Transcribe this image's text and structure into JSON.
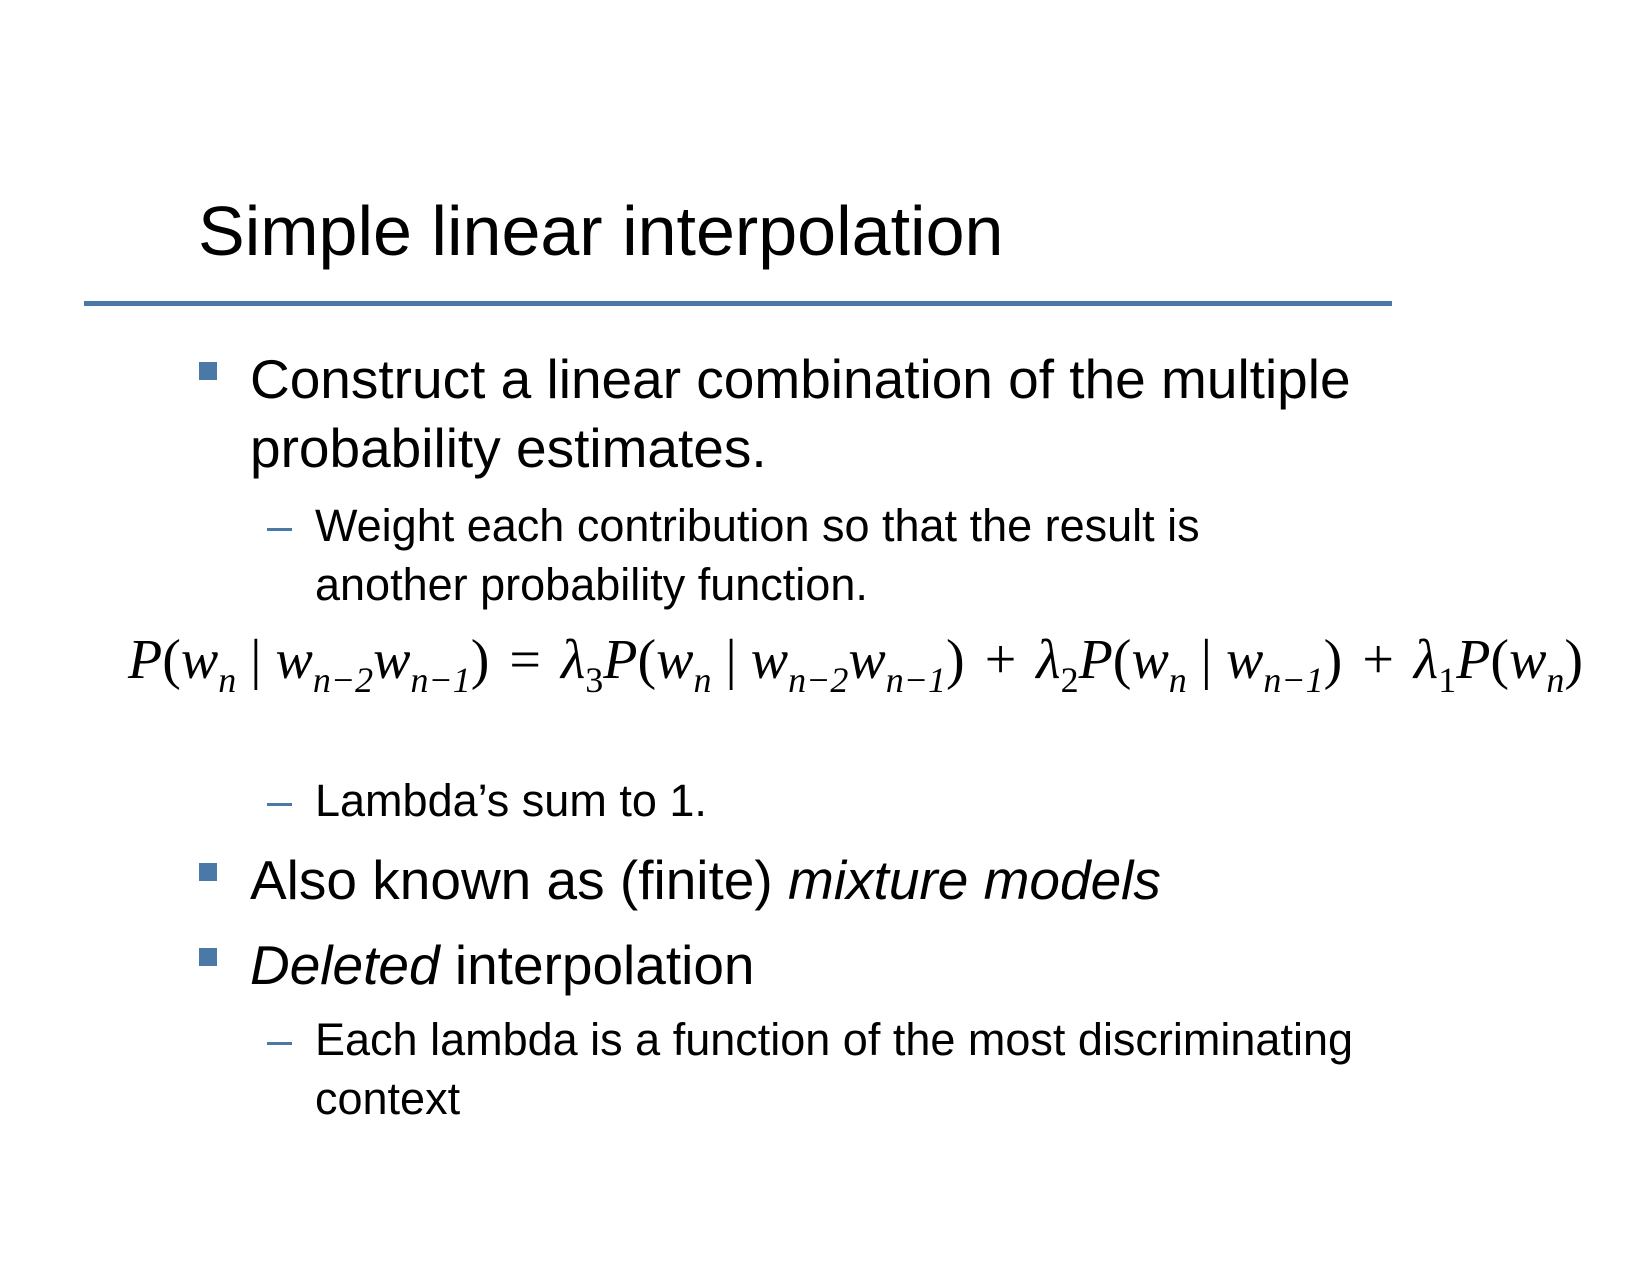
{
  "slide": {
    "title": "Simple linear interpolation",
    "accent_color": "#4a79a8"
  },
  "bullets": {
    "b1_line1": "Construct a linear combination of the multiple",
    "b1_line2": "probability estimates.",
    "b1_sub1_line1": "Weight each contribution so that the result is",
    "b1_sub1_line2": "another probability function.",
    "b1_sub2": "Lambda’s sum to 1.",
    "b2_plain": "Also known as (finite) ",
    "b2_italic": "mixture models",
    "b3_italic": "Deleted",
    "b3_plain": " interpolation",
    "b3_sub1_line1": "Each lambda is a function of the most discriminating",
    "b3_sub1_line2": "context"
  },
  "dash_char": "–",
  "formula": {
    "P": "P",
    "w": "w",
    "n": "n",
    "nm2": "n−2",
    "nm1": "n−1",
    "bar": "|",
    "lparen": "(",
    "rparen": ")",
    "eq": "=",
    "plus": "+",
    "lambda": "λ",
    "l3": "3",
    "l2": "2",
    "l1": "1"
  }
}
